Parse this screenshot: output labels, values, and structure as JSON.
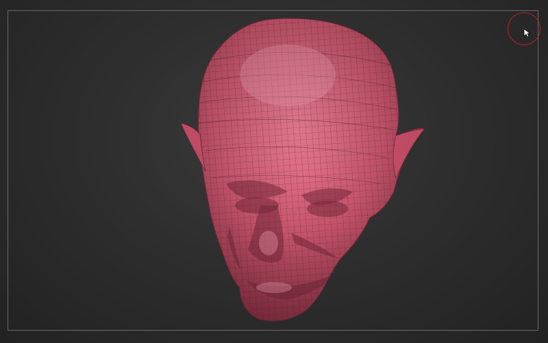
{
  "viewport": {
    "background_color": "#2e2e2e",
    "frame_color": "#6a6a6a"
  },
  "model": {
    "description_icon": "sculpted-head-mesh-icon",
    "surface_color": "#d35a72",
    "wire_color": "#5a2230"
  },
  "cursor": {
    "ring_color": "#b8232b",
    "icon": "arrow-pointer-icon"
  }
}
